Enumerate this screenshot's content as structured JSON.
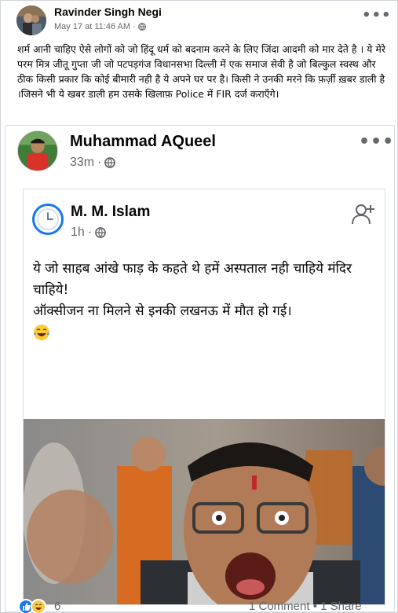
{
  "outer_post": {
    "author": "Ravinder Singh Negi",
    "timestamp": "May 17 at 11:46 AM",
    "meta_separator": "·",
    "text": "शर्म आनी चाहिए ऐसे लोगों को जो हिंदू धर्म को बदनाम करने के लिए जिंदा आदमी को मार देते है । ये मेरे परम मित्र जीतू गुप्ता जी जो पटपड़गंज विधानसभा दिल्ली  में एक समाज सेवी है जो बिल्कुल स्वस्थ और ठीक किसी प्रकार कि कोई बीमारी नही है ये अपने घर पर  है। किसी ने उनकी मरने कि फ़र्ज़ी ख़बर डाली है ।जिसने भी ये खबर डाली हम उसके खिलाफ़ Police में FIR दर्ज कराएँगे।"
  },
  "shared_post": {
    "author": "Muhammad AQueel",
    "timestamp": "33m",
    "meta_separator": "·"
  },
  "inner_post": {
    "author": "M. M. Islam",
    "timestamp": "1h",
    "meta_separator": "·",
    "line1": "ये जो साहब आंखे फाड़ के कहते थे हमें अस्पताल नही चाहिये मंदिर चाहिये!",
    "line2": "ऑक्सीजन ना मिलने से इनकी लखनऊ में मौत हो गई।",
    "emoji": "laughing-emoji"
  },
  "footer": {
    "reaction_count": "6",
    "stats": "1 Comment • 1 Share"
  },
  "icons": {
    "globe": "globe-icon",
    "more": "more-options-icon",
    "add_friend": "add-friend-icon",
    "like": "like-reaction-icon",
    "haha": "haha-reaction-icon"
  },
  "colors": {
    "facebook_blue": "#1877f2",
    "secondary_text": "#65676b",
    "primary_text": "#050505"
  }
}
